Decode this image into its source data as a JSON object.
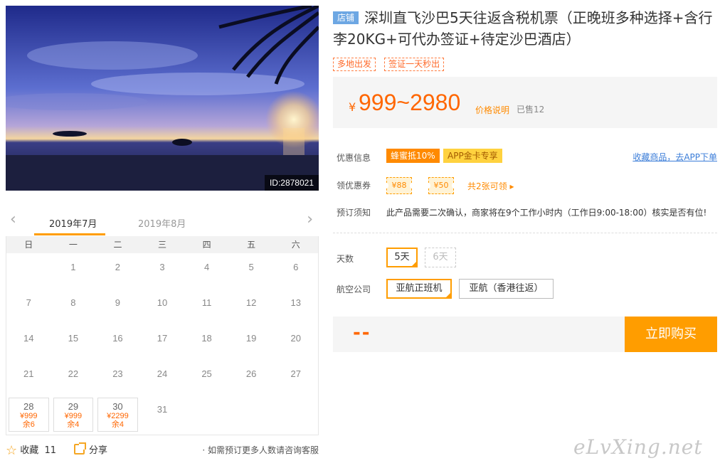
{
  "photo": {
    "id_label": "ID:2878021"
  },
  "calendar": {
    "months": [
      "2019年7月",
      "2019年8月"
    ],
    "weekdays": [
      "日",
      "一",
      "二",
      "三",
      "四",
      "五",
      "六"
    ],
    "days": [
      {
        "d": ""
      },
      {
        "d": "1"
      },
      {
        "d": "2"
      },
      {
        "d": "3"
      },
      {
        "d": "4"
      },
      {
        "d": "5"
      },
      {
        "d": "6"
      },
      {
        "d": "7"
      },
      {
        "d": "8"
      },
      {
        "d": "9"
      },
      {
        "d": "10"
      },
      {
        "d": "11"
      },
      {
        "d": "12"
      },
      {
        "d": "13"
      },
      {
        "d": "14"
      },
      {
        "d": "15"
      },
      {
        "d": "16"
      },
      {
        "d": "17"
      },
      {
        "d": "18"
      },
      {
        "d": "19"
      },
      {
        "d": "20"
      },
      {
        "d": "21"
      },
      {
        "d": "22"
      },
      {
        "d": "23"
      },
      {
        "d": "24"
      },
      {
        "d": "25"
      },
      {
        "d": "26"
      },
      {
        "d": "27"
      },
      {
        "d": "28",
        "price": "¥999",
        "remain": "余6"
      },
      {
        "d": "29",
        "price": "¥999",
        "remain": "余4"
      },
      {
        "d": "30",
        "price": "¥2299",
        "remain": "余4"
      },
      {
        "d": "31"
      }
    ]
  },
  "share_bar": {
    "favorite_label": "收藏",
    "favorite_count": "11",
    "share_label": "分享",
    "tip": "· 如需预订更多人数请咨询客服"
  },
  "product": {
    "store_badge": "店铺",
    "title": "深圳直飞沙巴5天往返含税机票（正晚班多种选择+含行李20KG+可代办签证+待定沙巴酒店）",
    "tags": [
      "多地出发",
      "签证一天秒出"
    ]
  },
  "price": {
    "currency": "¥",
    "range": "999~2980",
    "explain_link": "价格说明",
    "sold": "已售12"
  },
  "offers": {
    "label": "优惠信息",
    "badge1": "蜂蜜抵10%",
    "badge2": "APP金卡专享",
    "fav_link": "收藏商品，去APP下单"
  },
  "coupons": {
    "label": "领优惠券",
    "items": [
      "¥88",
      "¥50"
    ],
    "more": "共2张可领 ▸"
  },
  "notice": {
    "label": "预订须知",
    "text": "此产品需要二次确认，商家将在9个工作小时内（工作日9:00-18:00）核实是否有位!"
  },
  "options": {
    "days_label": "天数",
    "days": [
      "5天",
      "6天"
    ],
    "airline_label": "航空公司",
    "airlines": [
      "亚航正班机",
      "亚航（香港往返）"
    ]
  },
  "buy": {
    "total": "--",
    "button": "立即购买"
  },
  "watermark": "eLvXing.net",
  "colors": {
    "accent": "#ff9d00",
    "price": "#ff6600",
    "link": "#3b7dd8",
    "store_badge": "#6da7e3"
  }
}
